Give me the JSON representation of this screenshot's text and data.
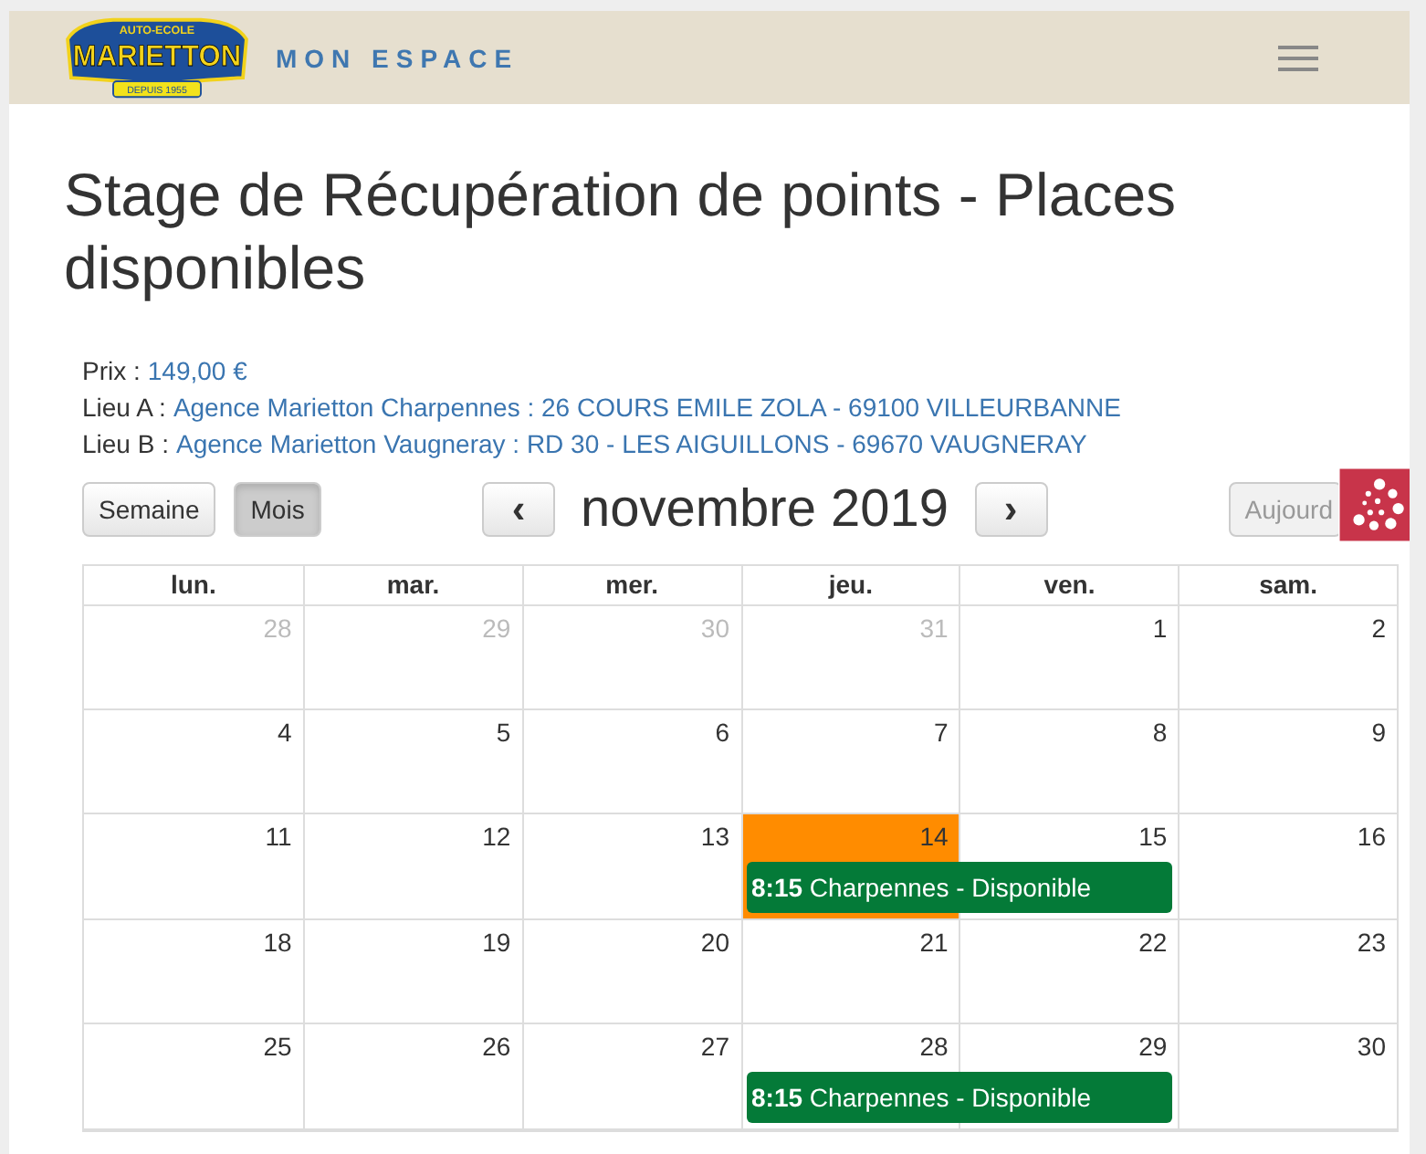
{
  "header": {
    "logo": {
      "top": "AUTO-ECOLE",
      "name": "MARIETTON",
      "since": "DEPUIS 1955"
    },
    "title": "MON ESPACE"
  },
  "title": "Stage de Récupération de points - Places disponibles",
  "info": [
    {
      "label": "Prix :",
      "value": "149,00 €"
    },
    {
      "label": "Lieu A :",
      "value": "Agence Marietton Charpennes : 26 COURS EMILE ZOLA - 69100 VILLEURBANNE"
    },
    {
      "label": "Lieu B :",
      "value": "Agence Marietton Vaugneray : RD 30 - LES AIGUILLONS - 69670 VAUGNERAY"
    }
  ],
  "views": [
    {
      "label": "Semaine",
      "selected": false
    },
    {
      "label": "Mois",
      "selected": true
    }
  ],
  "nav": {
    "prev": "‹",
    "month": "novembre 2019",
    "next": "›",
    "today": "Aujourd"
  },
  "calendar": {
    "days": [
      "lun.",
      "mar.",
      "mer.",
      "jeu.",
      "ven.",
      "sam."
    ],
    "weeks": [
      {
        "dates": [
          {
            "n": "28",
            "other": true,
            "today": false
          },
          {
            "n": "29",
            "other": true,
            "today": false
          },
          {
            "n": "30",
            "other": true,
            "today": false
          },
          {
            "n": "31",
            "other": true,
            "today": false
          },
          {
            "n": "1",
            "other": false,
            "today": false
          },
          {
            "n": "2",
            "other": false,
            "today": false
          }
        ]
      },
      {
        "dates": [
          {
            "n": "4",
            "other": false,
            "today": false
          },
          {
            "n": "5",
            "other": false,
            "today": false
          },
          {
            "n": "6",
            "other": false,
            "today": false
          },
          {
            "n": "7",
            "other": false,
            "today": false
          },
          {
            "n": "8",
            "other": false,
            "today": false
          },
          {
            "n": "9",
            "other": false,
            "today": false
          }
        ]
      },
      {
        "dates": [
          {
            "n": "11",
            "other": false,
            "today": false
          },
          {
            "n": "12",
            "other": false,
            "today": false
          },
          {
            "n": "13",
            "other": false,
            "today": false
          },
          {
            "n": "14",
            "other": false,
            "today": true,
            "events": [
              {
                "time": "8:15",
                "title": "Charpennes - Disponible"
              }
            ]
          },
          {
            "n": "15",
            "other": false,
            "today": false
          },
          {
            "n": "16",
            "other": false,
            "today": false
          }
        ]
      },
      {
        "dates": [
          {
            "n": "18",
            "other": false,
            "today": false
          },
          {
            "n": "19",
            "other": false,
            "today": false
          },
          {
            "n": "20",
            "other": false,
            "today": false
          },
          {
            "n": "21",
            "other": false,
            "today": false
          },
          {
            "n": "22",
            "other": false,
            "today": false
          },
          {
            "n": "23",
            "other": false,
            "today": false
          }
        ]
      },
      {
        "dates": [
          {
            "n": "25",
            "other": false,
            "today": false
          },
          {
            "n": "26",
            "other": false,
            "today": false
          },
          {
            "n": "27",
            "other": false,
            "today": false
          },
          {
            "n": "28",
            "other": false,
            "today": false,
            "events": [
              {
                "time": "8:15",
                "title": "Charpennes - Disponible"
              }
            ]
          },
          {
            "n": "29",
            "other": false,
            "today": false
          },
          {
            "n": "30",
            "other": false,
            "today": false
          }
        ]
      }
    ]
  }
}
